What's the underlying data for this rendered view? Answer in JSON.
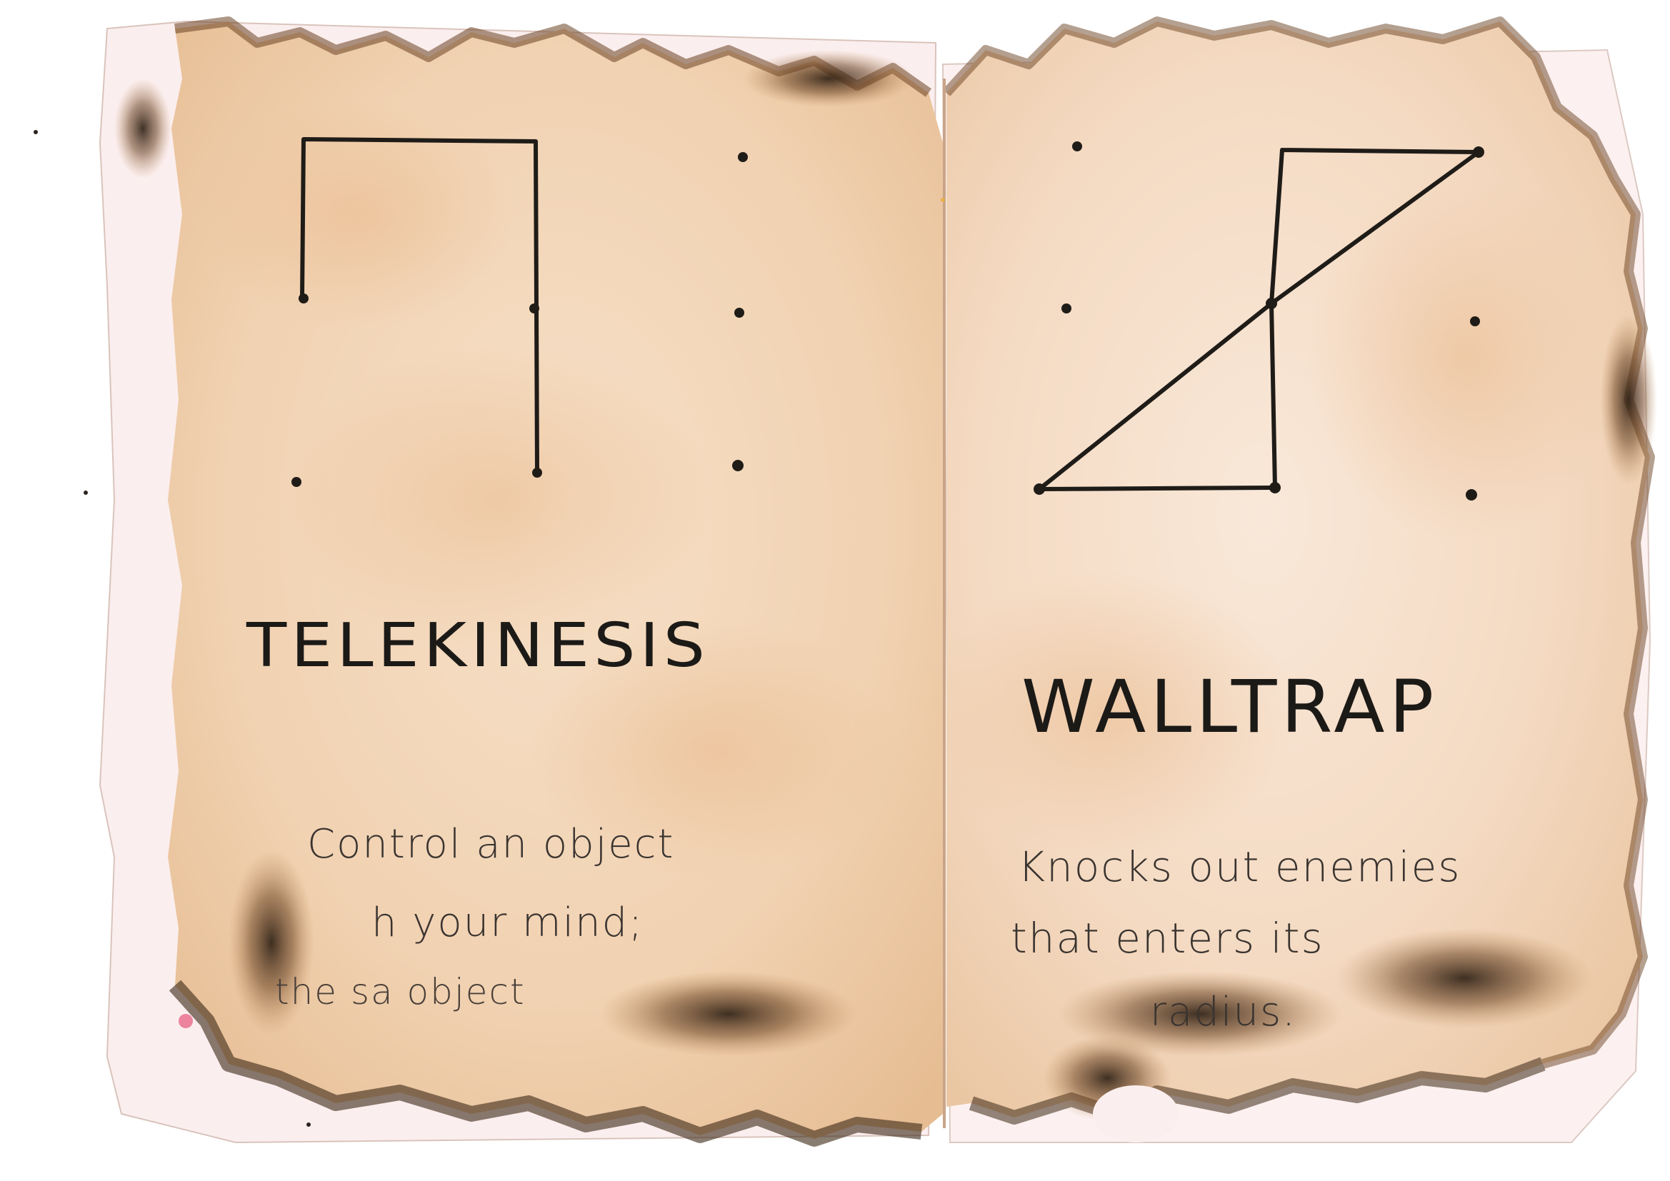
{
  "left_page": {
    "title": "TELEKINESIS",
    "description": [
      "Control  an  object",
      "h  your  mind;",
      "the  sa          object"
    ]
  },
  "right_page": {
    "title": "WALLTRAP",
    "description": [
      "Knocks  out  enemies",
      "that  enters    its",
      "radius."
    ]
  },
  "colors": {
    "paper": "#f4d9bf",
    "paper_light": "#f8e6d4",
    "burn": "#3a2a1c",
    "ink": "#1c1a17",
    "background": "#ffffff"
  }
}
